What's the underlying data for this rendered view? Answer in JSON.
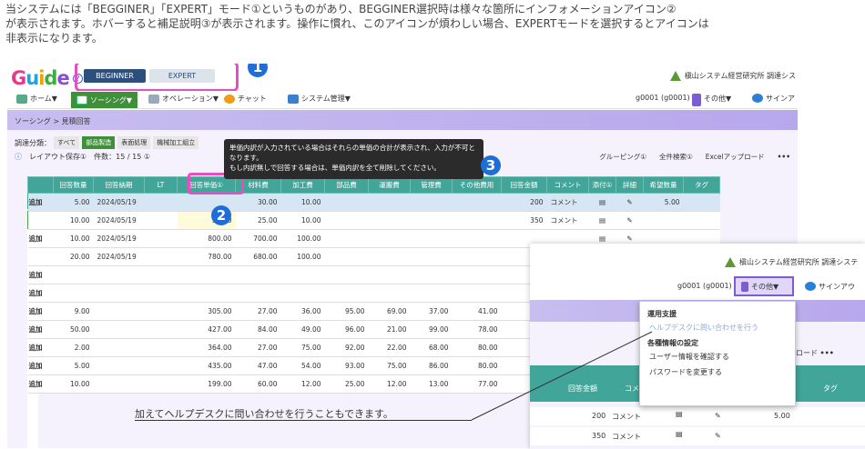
{
  "description": {
    "line1": "当システムには「BEGGINER」「EXPERT」モード①というものがあり、BEGGINER選択時は様々な箇所にインフォメーションアイコン②",
    "line2": "が表示されます。ホバーすると補足説明③が表示されます。操作に慣れ、このアイコンが煩わしい場合、EXPERTモードを選択するとアイコンは",
    "line3": "非表示になります。"
  },
  "brand": {
    "logo": "Guide",
    "company": "槇山システム経営研究所 調達シス"
  },
  "mode": {
    "beginner": "BEGINNER",
    "expert": "EXPERT"
  },
  "nav": {
    "home": "ホーム▼",
    "sourcing": "ソーシング▼",
    "operation": "オペレーション▼",
    "chat": "チャット",
    "system": "システム管理▼",
    "user": "g0001 (g0001)",
    "other": "その他▼",
    "signin": "サインア"
  },
  "breadcrumb": "ソーシング > 見積回答",
  "filters": {
    "label": "調達分類：",
    "chips": [
      "すべて",
      "部品製造",
      "表面処理",
      "機械加工組立"
    ]
  },
  "toolbar": {
    "save_layout": "レイアウト保存①",
    "count": "件数：15 / 15 ①",
    "grouping": "グルーピング①",
    "fulltext": "全件検索①",
    "excel": "Excelアップロード",
    "more": "•••"
  },
  "tooltip": {
    "line1": "単価内訳が入力されている場合はそれらの単価の合計が表示され、入力が不可と",
    "line2": "なります。",
    "line3": "もし内訳無しで回答する場合は、単価内訳を全て削除してください。"
  },
  "badges": [
    "1",
    "2",
    "3"
  ],
  "table": {
    "headers": [
      "回答数量",
      "回答納期",
      "LT",
      "回答単価①",
      "材料費",
      "加工費",
      "部品費",
      "運搬費",
      "管理費",
      "その他費用",
      "回答金額",
      "コメント",
      "添付①",
      "詳細",
      "希望数量",
      "タグ"
    ],
    "rows": [
      {
        "flag": "追加",
        "qty": "5.00",
        "date": "2024/05/19",
        "price": "",
        "mat": "30.00",
        "proc": "10.00",
        "parts": "",
        "trans": "",
        "mgmt": "",
        "other": "",
        "amount": "200",
        "comment": "コメント",
        "hope": "5.00"
      },
      {
        "flag": "",
        "qty": "10.00",
        "date": "2024/05/19",
        "price": "35.00",
        "mat": "25.00",
        "proc": "10.00",
        "parts": "",
        "trans": "",
        "mgmt": "",
        "other": "",
        "amount": "350",
        "comment": "コメント",
        "hope": ""
      },
      {
        "flag": "追加",
        "qty": "10.00",
        "date": "2024/05/19",
        "price": "800.00",
        "mat": "700.00",
        "proc": "100.00",
        "parts": "",
        "trans": "",
        "mgmt": "",
        "other": "",
        "amount": "",
        "comment": "",
        "hope": ""
      },
      {
        "flag": "",
        "qty": "20.00",
        "date": "2024/05/19",
        "price": "780.00",
        "mat": "680.00",
        "proc": "100.00",
        "parts": "",
        "trans": "",
        "mgmt": "",
        "other": "",
        "amount": "",
        "comment": "",
        "hope": ""
      },
      {
        "flag": "追加",
        "qty": "",
        "date": "",
        "price": "",
        "mat": "",
        "proc": "",
        "parts": "",
        "trans": "",
        "mgmt": "",
        "other": "",
        "amount": "",
        "comment": "",
        "hope": ""
      },
      {
        "flag": "追加",
        "qty": "",
        "date": "",
        "price": "",
        "mat": "",
        "proc": "",
        "parts": "",
        "trans": "",
        "mgmt": "",
        "other": "",
        "amount": "",
        "comment": "",
        "hope": ""
      },
      {
        "flag": "追加",
        "qty": "9.00",
        "date": "",
        "price": "305.00",
        "mat": "27.00",
        "proc": "36.00",
        "parts": "95.00",
        "trans": "69.00",
        "mgmt": "37.00",
        "other": "41.00",
        "amount": "",
        "comment": "",
        "hope": ""
      },
      {
        "flag": "追加",
        "qty": "50.00",
        "date": "",
        "price": "427.00",
        "mat": "84.00",
        "proc": "49.00",
        "parts": "96.00",
        "trans": "21.00",
        "mgmt": "99.00",
        "other": "78.00",
        "amount": "",
        "comment": "",
        "hope": ""
      },
      {
        "flag": "追加",
        "qty": "2.00",
        "date": "",
        "price": "364.00",
        "mat": "27.00",
        "proc": "75.00",
        "parts": "92.00",
        "trans": "22.00",
        "mgmt": "68.00",
        "other": "80.00",
        "amount": "",
        "comment": "",
        "hope": ""
      },
      {
        "flag": "追加",
        "qty": "5.00",
        "date": "",
        "price": "435.00",
        "mat": "47.00",
        "proc": "54.00",
        "parts": "93.00",
        "trans": "75.00",
        "mgmt": "86.00",
        "other": "80.00",
        "amount": "",
        "comment": "",
        "hope": ""
      },
      {
        "flag": "追加",
        "qty": "10.00",
        "date": "",
        "price": "199.00",
        "mat": "60.00",
        "proc": "12.00",
        "parts": "25.00",
        "trans": "12.00",
        "mgmt": "13.00",
        "other": "77.00",
        "amount": "",
        "comment": "",
        "hope": ""
      }
    ]
  },
  "callout": "加えてヘルプデスクに問い合わせを行うこともできます。",
  "overlay": {
    "company": "槇山システム経営研究所 調達システ",
    "user": "g0001 (g0001)",
    "other": "その他▼",
    "signin": "サインアウ",
    "excel": "ロード",
    "more": "•••",
    "headers": [
      "回答金額",
      "コメ",
      "タグ"
    ],
    "rows": [
      {
        "amount": "200",
        "comment": "コメント",
        "hope": "5.00"
      },
      {
        "amount": "350",
        "comment": "コメント",
        "hope": ""
      }
    ]
  },
  "menu": {
    "section1": "運用支援",
    "helpdesk": "ヘルプデスクに問い合わせを行う",
    "section2": "各種情報の設定",
    "userinfo": "ユーザー情報を確認する",
    "password": "パスワードを変更する"
  },
  "colors": {
    "accent": "#e64fc1",
    "header": "#41a59a",
    "nav_selected": "#3f8f3b",
    "badge": "#1f6ed8",
    "mode_on": "#2d4f7c"
  }
}
